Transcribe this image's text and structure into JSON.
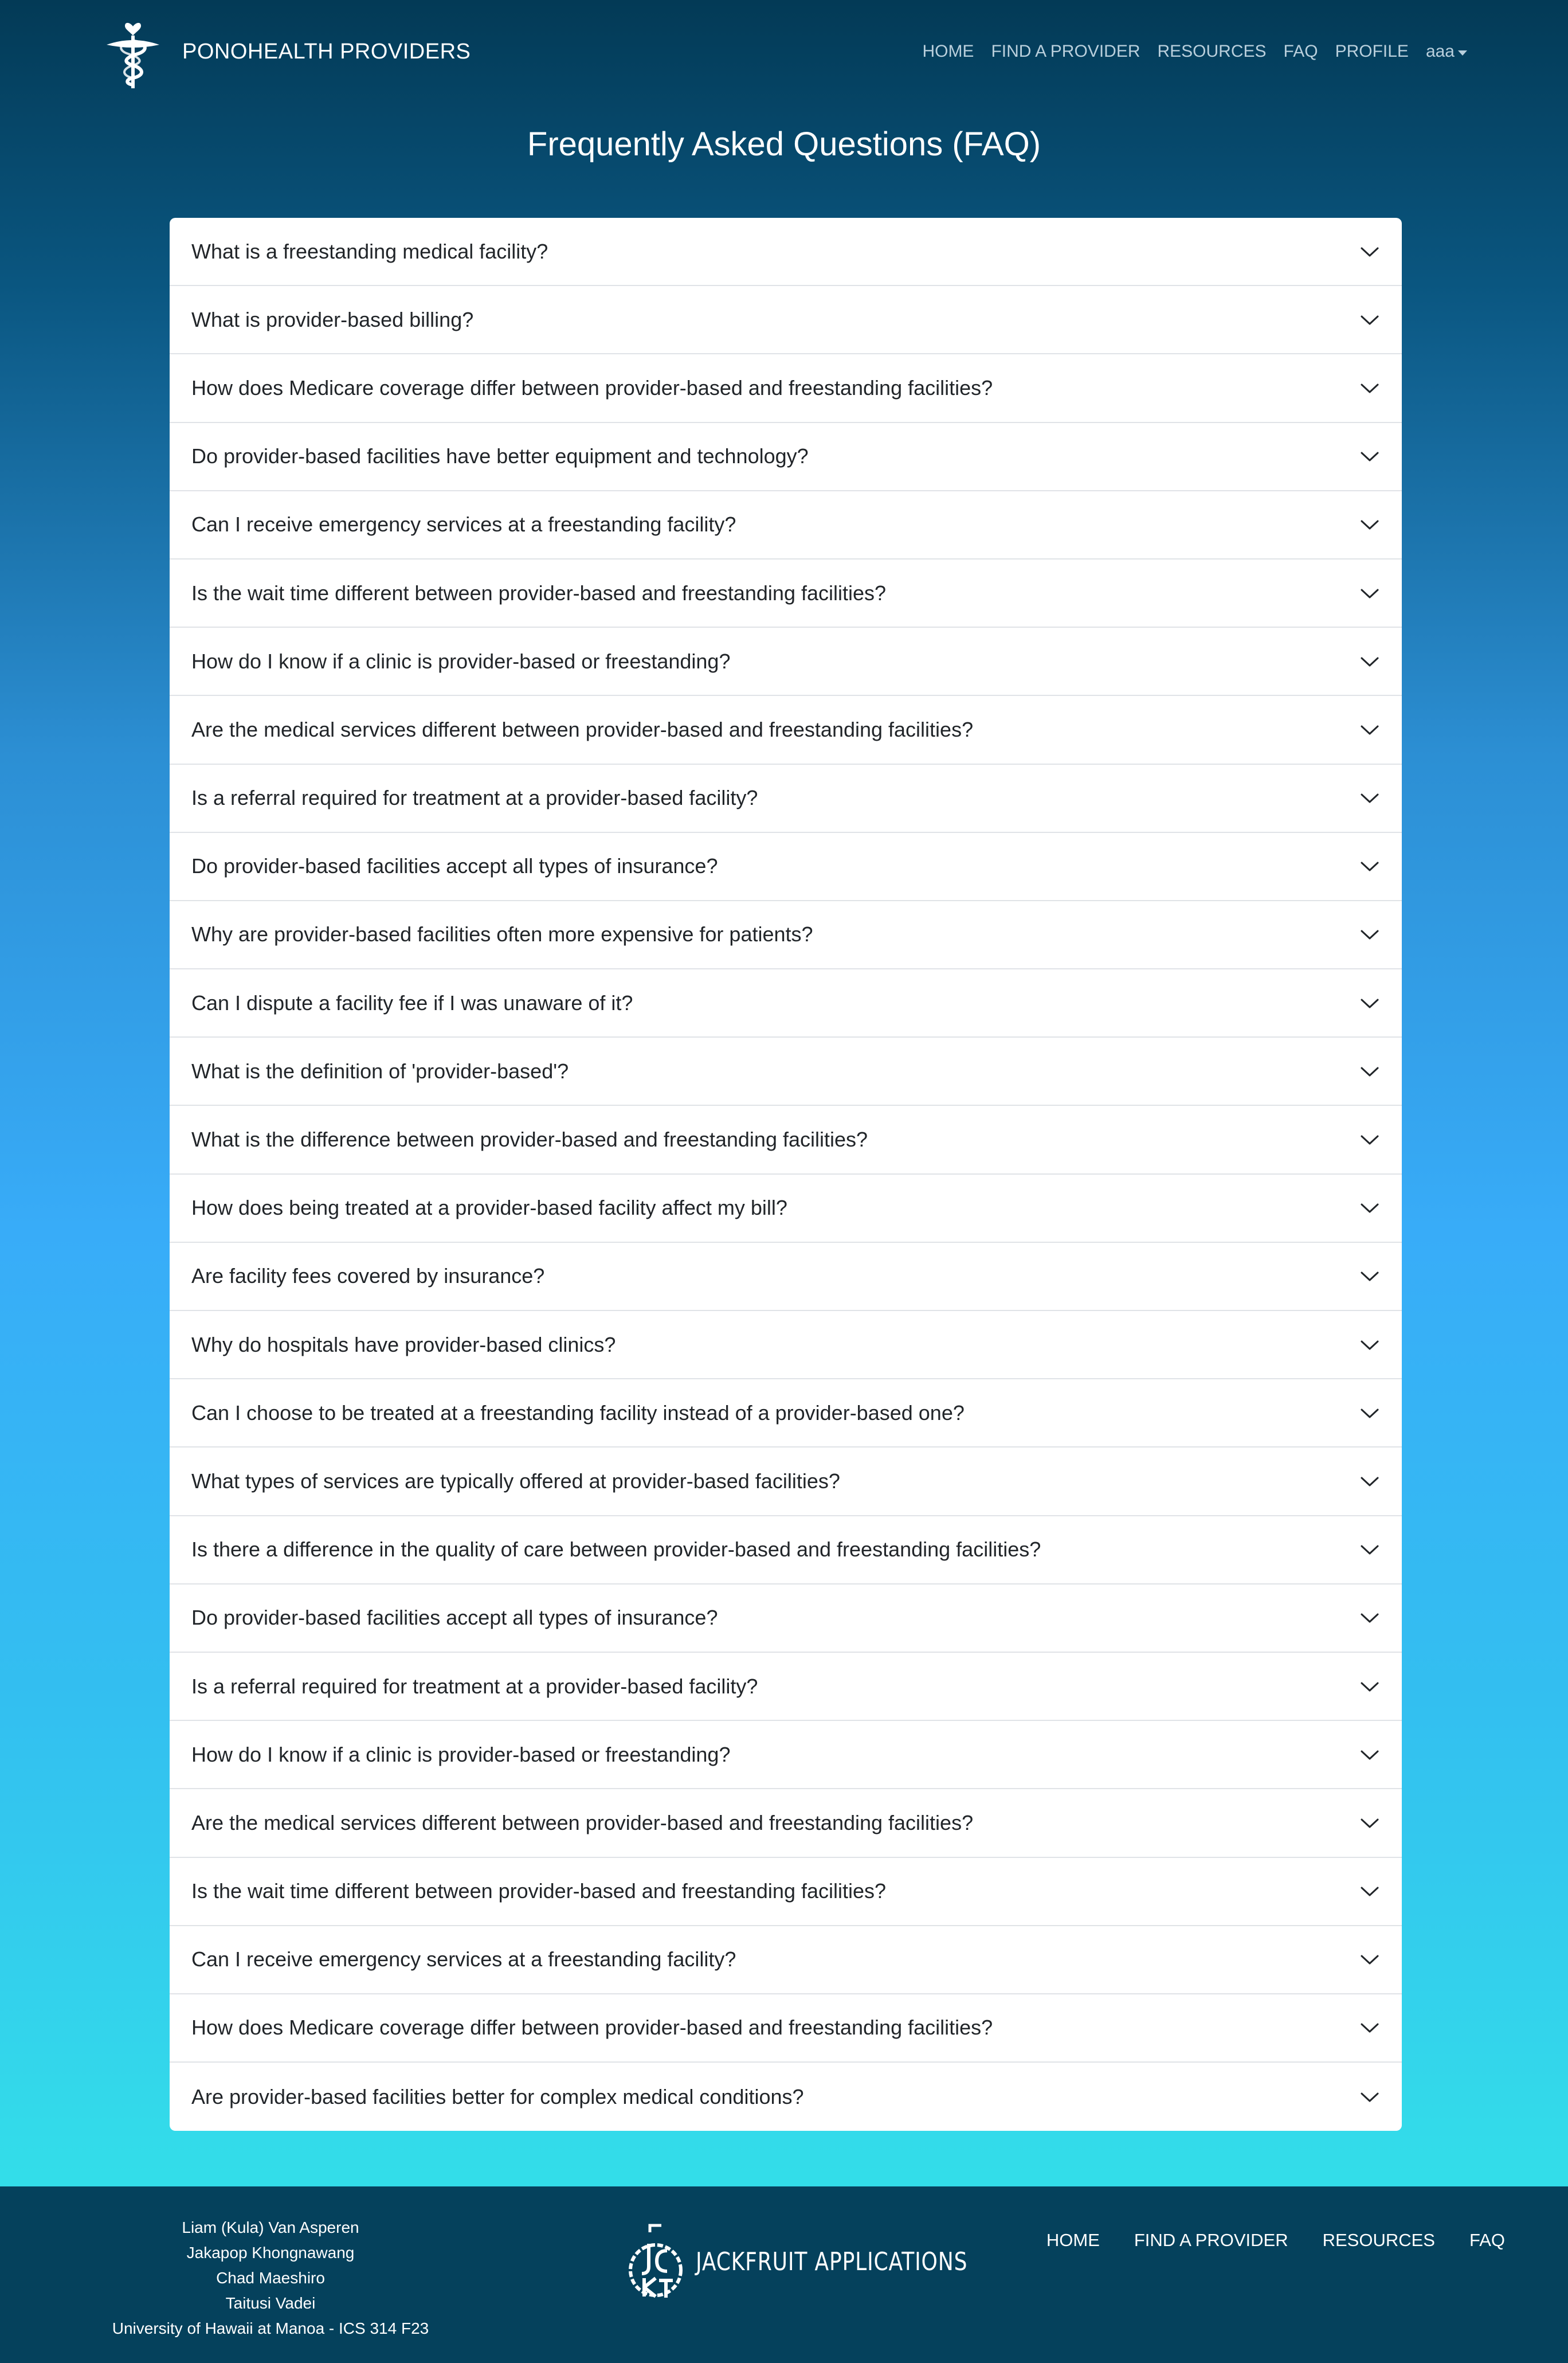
{
  "navbar": {
    "brand": "PONOHEALTH PROVIDERS",
    "links": [
      "HOME",
      "FIND A PROVIDER",
      "RESOURCES",
      "FAQ",
      "PROFILE"
    ],
    "user": "aaa"
  },
  "page": {
    "title": "Frequently Asked Questions (FAQ)"
  },
  "faq": [
    "What is a freestanding medical facility?",
    "What is provider-based billing?",
    "How does Medicare coverage differ between provider-based and freestanding facilities?",
    "Do provider-based facilities have better equipment and technology?",
    "Can I receive emergency services at a freestanding facility?",
    "Is the wait time different between provider-based and freestanding facilities?",
    "How do I know if a clinic is provider-based or freestanding?",
    "Are the medical services different between provider-based and freestanding facilities?",
    "Is a referral required for treatment at a provider-based facility?",
    "Do provider-based facilities accept all types of insurance?",
    "Why are provider-based facilities often more expensive for patients?",
    "Can I dispute a facility fee if I was unaware of it?",
    "What is the definition of 'provider-based'?",
    "What is the difference between provider-based and freestanding facilities?",
    "How does being treated at a provider-based facility affect my bill?",
    "Are facility fees covered by insurance?",
    "Why do hospitals have provider-based clinics?",
    "Can I choose to be treated at a freestanding facility instead of a provider-based one?",
    "What types of services are typically offered at provider-based facilities?",
    "Is there a difference in the quality of care between provider-based and freestanding facilities?",
    "Do provider-based facilities accept all types of insurance?",
    "Is a referral required for treatment at a provider-based facility?",
    "How do I know if a clinic is provider-based or freestanding?",
    "Are the medical services different between provider-based and freestanding facilities?",
    "Is the wait time different between provider-based and freestanding facilities?",
    "Can I receive emergency services at a freestanding facility?",
    "How does Medicare coverage differ between provider-based and freestanding facilities?",
    "Are provider-based facilities better for complex medical conditions?"
  ],
  "footer": {
    "credits": [
      "Liam (Kula) Van Asperen",
      "Jakapop Khongnawang",
      "Chad Maeshiro",
      "Taitusi Vadei",
      "University of Hawaii at Manoa - ICS 314 F23"
    ],
    "logo_text": "JACKFRUIT APPLICATIONS",
    "links": [
      "HOME",
      "FIND A PROVIDER",
      "RESOURCES",
      "FAQ"
    ]
  },
  "icons": {
    "brand": "caduceus-heart-icon",
    "accordion_toggle": "chevron-down-icon",
    "footer_logo": "jackfruit-logo-icon",
    "user_menu": "caret-down-icon"
  }
}
